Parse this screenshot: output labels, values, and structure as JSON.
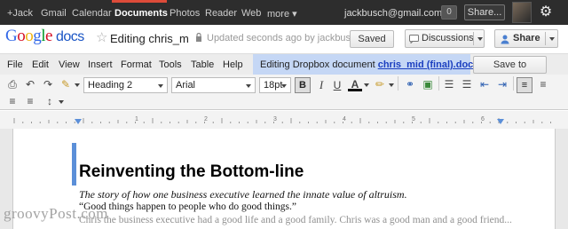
{
  "google_bar": {
    "links": [
      "+Jack",
      "Gmail",
      "Calendar",
      "Documents",
      "Photos",
      "Reader",
      "Web",
      "more ▾"
    ],
    "active": "Documents",
    "email": "jackbusch@gmail.com",
    "badge": "0",
    "share_label": "Share...",
    "gear_icon": "gear-icon"
  },
  "header": {
    "logo_google": "Google",
    "logo_docs": "docs",
    "doc_title": "Editing chris_m",
    "save_status": "Updated seconds ago by jackbusch",
    "saved_label": "Saved",
    "discussions_label": "Discussions",
    "share_label": "Share"
  },
  "menu": {
    "items": [
      "File",
      "Edit",
      "View",
      "Insert",
      "Format",
      "Tools",
      "Table",
      "Help"
    ],
    "dropbox_prefix": "Editing Dropbox document",
    "dropbox_file": "chris_mid (final).docx",
    "save_to_dropbox": "Save to Dropbox"
  },
  "toolbar": {
    "style_select": "Heading 2",
    "font_select": "Arial",
    "size_select": "18pt",
    "bold": "B",
    "italic": "I",
    "underline": "U",
    "text_color": "A"
  },
  "ruler": {
    "numbers": [
      "1",
      "2",
      "3",
      "4",
      "5",
      "6"
    ]
  },
  "document": {
    "heading": "Reinventing the Bottom-line",
    "subtitle": "The story of how one business executive learned the innate value of altruism.",
    "quote": "“Good things happen to people who do good things.”",
    "cut_line": "Chris the business executive had a good life and a good family. Chris was a good man and a good friend..."
  },
  "watermark": "groovyPost.com",
  "colors": {
    "google_bar_bg": "#2d2d2d",
    "active_red": "#dd4b39",
    "dropbox_highlight": "#c5d7f5",
    "link_blue": "#1a3ebf"
  }
}
